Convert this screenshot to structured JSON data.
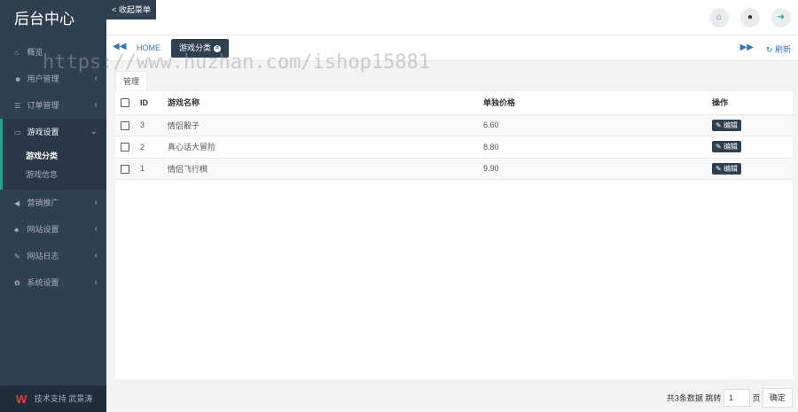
{
  "sidebar": {
    "brand": "后台中心",
    "items": [
      {
        "label": "概览",
        "icon": "home-icon",
        "glyph": "⌂",
        "has_children": false
      },
      {
        "label": "用户管理",
        "icon": "users-icon",
        "glyph": "☻",
        "has_children": true
      },
      {
        "label": "订单管理",
        "icon": "list-icon",
        "glyph": "☰",
        "has_children": true
      },
      {
        "label": "游戏设置",
        "icon": "gamepad-icon",
        "glyph": "▭",
        "has_children": true,
        "open": true,
        "children": [
          {
            "label": "游戏分类",
            "active": true
          },
          {
            "label": "游戏信息",
            "active": false
          }
        ]
      },
      {
        "label": "营销推广",
        "icon": "bullhorn-icon",
        "glyph": "◀",
        "has_children": true
      },
      {
        "label": "网站设置",
        "icon": "sitemap-icon",
        "glyph": "♣",
        "has_children": true
      },
      {
        "label": "网站日志",
        "icon": "edit-icon",
        "glyph": "✎",
        "has_children": true
      },
      {
        "label": "系统设置",
        "icon": "gear-icon",
        "glyph": "✿",
        "has_children": true
      }
    ],
    "footer": "技术支持 武景涛"
  },
  "header": {
    "collapse_label": "< 收起菜单"
  },
  "tabs": {
    "home_label": "HOME",
    "active_label": "游戏分类",
    "refresh_label": "刷新"
  },
  "content": {
    "subtab_label": "管理",
    "table": {
      "columns": [
        "ID",
        "游戏名称",
        "单独价格",
        "操作"
      ],
      "rows": [
        {
          "id": "3",
          "name": "情侣骰子",
          "price": "6.60",
          "action": "编辑"
        },
        {
          "id": "2",
          "name": "真心话大冒险",
          "price": "8.80",
          "action": "编辑"
        },
        {
          "id": "1",
          "name": "情侣飞行棋",
          "price": "9.90",
          "action": "编辑"
        }
      ]
    }
  },
  "pagination": {
    "total_text": "共3条数据",
    "jump_label": "跳转",
    "page_value": "1",
    "page_unit": "页",
    "confirm_label": "确定"
  },
  "watermark": "https://www.huzhan.com/ishop15881",
  "colors": {
    "sidebar_bg": "#2f4050",
    "accent": "#19aa8d",
    "link": "#2f77b7"
  }
}
